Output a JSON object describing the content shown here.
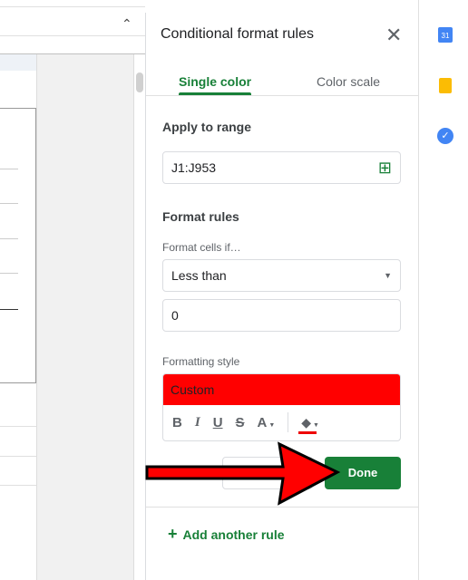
{
  "panel": {
    "title": "Conditional format rules",
    "tabs": [
      {
        "label": "Single color",
        "active": true
      },
      {
        "label": "Color scale",
        "active": false
      }
    ],
    "apply_to_range_label": "Apply to range",
    "range_value": "J1:J953",
    "format_rules_label": "Format rules",
    "format_cells_if_label": "Format cells if…",
    "condition": "Less than",
    "value": "0",
    "formatting_style_label": "Formatting style",
    "style_preview": "Custom",
    "style_color": "#ff0000",
    "toolbar": {
      "bold": "B",
      "italic": "I",
      "underline": "U",
      "strike": "S",
      "text_color": "A"
    },
    "done_label": "Done",
    "add_rule_label": "Add another rule",
    "add_icon": "+"
  },
  "accent": "#188038",
  "side_icons": [
    "calendar-icon",
    "keep-icon",
    "tasks-icon"
  ],
  "calendar_day": "31"
}
